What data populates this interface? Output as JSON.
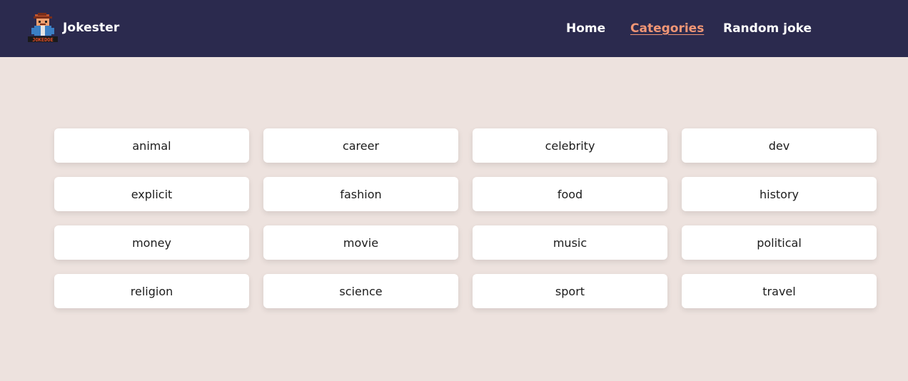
{
  "brand": {
    "name": "Jokester",
    "logo_text": "JOKEDOE",
    "logo_icon": "cowboy-mascot-logo"
  },
  "nav": {
    "home": "Home",
    "categories": "Categories",
    "random": "Random joke",
    "active": "Categories"
  },
  "colors": {
    "header_bg": "#2b2a4e",
    "page_bg": "#ede2de",
    "active_link": "#f19675",
    "card_bg": "#ffffff"
  },
  "categories": [
    "animal",
    "career",
    "celebrity",
    "dev",
    "explicit",
    "fashion",
    "food",
    "history",
    "money",
    "movie",
    "music",
    "political",
    "religion",
    "science",
    "sport",
    "travel"
  ]
}
